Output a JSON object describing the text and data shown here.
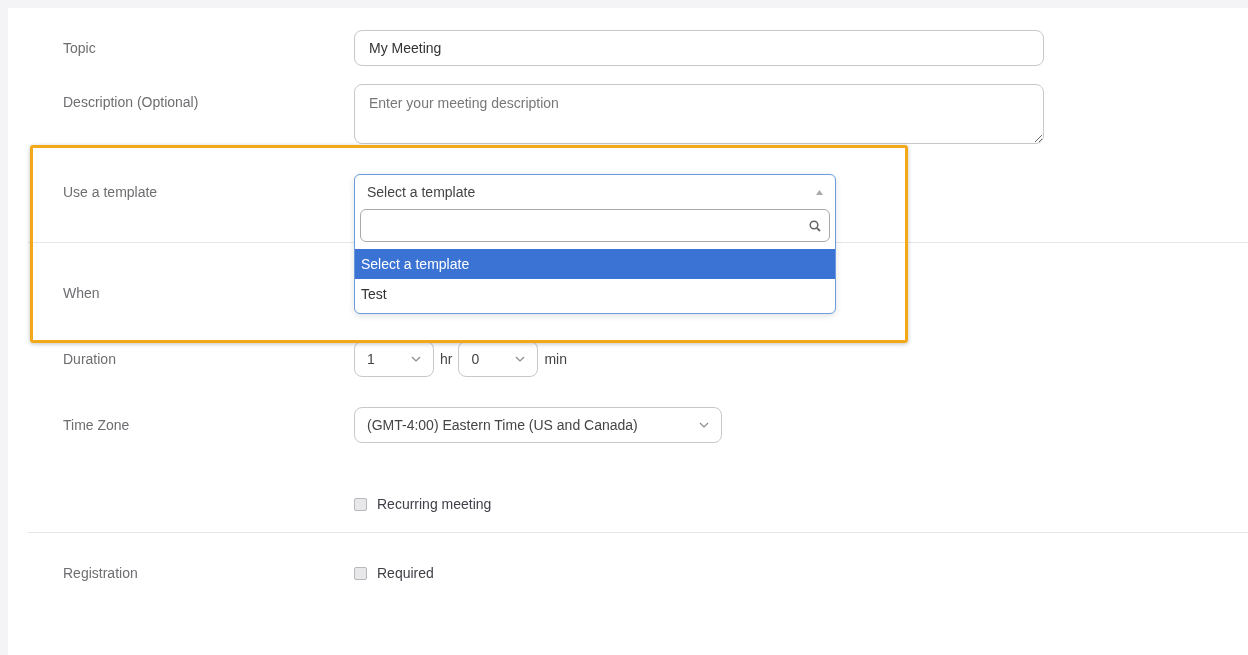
{
  "topic": {
    "label": "Topic",
    "value": "My Meeting"
  },
  "description": {
    "label": "Description (Optional)",
    "placeholder": "Enter your meeting description"
  },
  "template": {
    "label": "Use a template",
    "value": "Select a template",
    "expanded": true,
    "highlighted": true,
    "options": [
      {
        "label": "Select a template",
        "selected": true
      },
      {
        "label": "Test",
        "selected": false
      }
    ]
  },
  "when": {
    "label": "When"
  },
  "duration": {
    "label": "Duration",
    "hours": "1",
    "hours_unit": "hr",
    "minutes": "0",
    "minutes_unit": "min"
  },
  "time_zone": {
    "label": "Time Zone",
    "value": "(GMT-4:00) Eastern Time (US and Canada)"
  },
  "recurring": {
    "label": "Recurring meeting",
    "checked": false
  },
  "registration": {
    "label": "Registration",
    "option": "Required",
    "checked": false
  }
}
